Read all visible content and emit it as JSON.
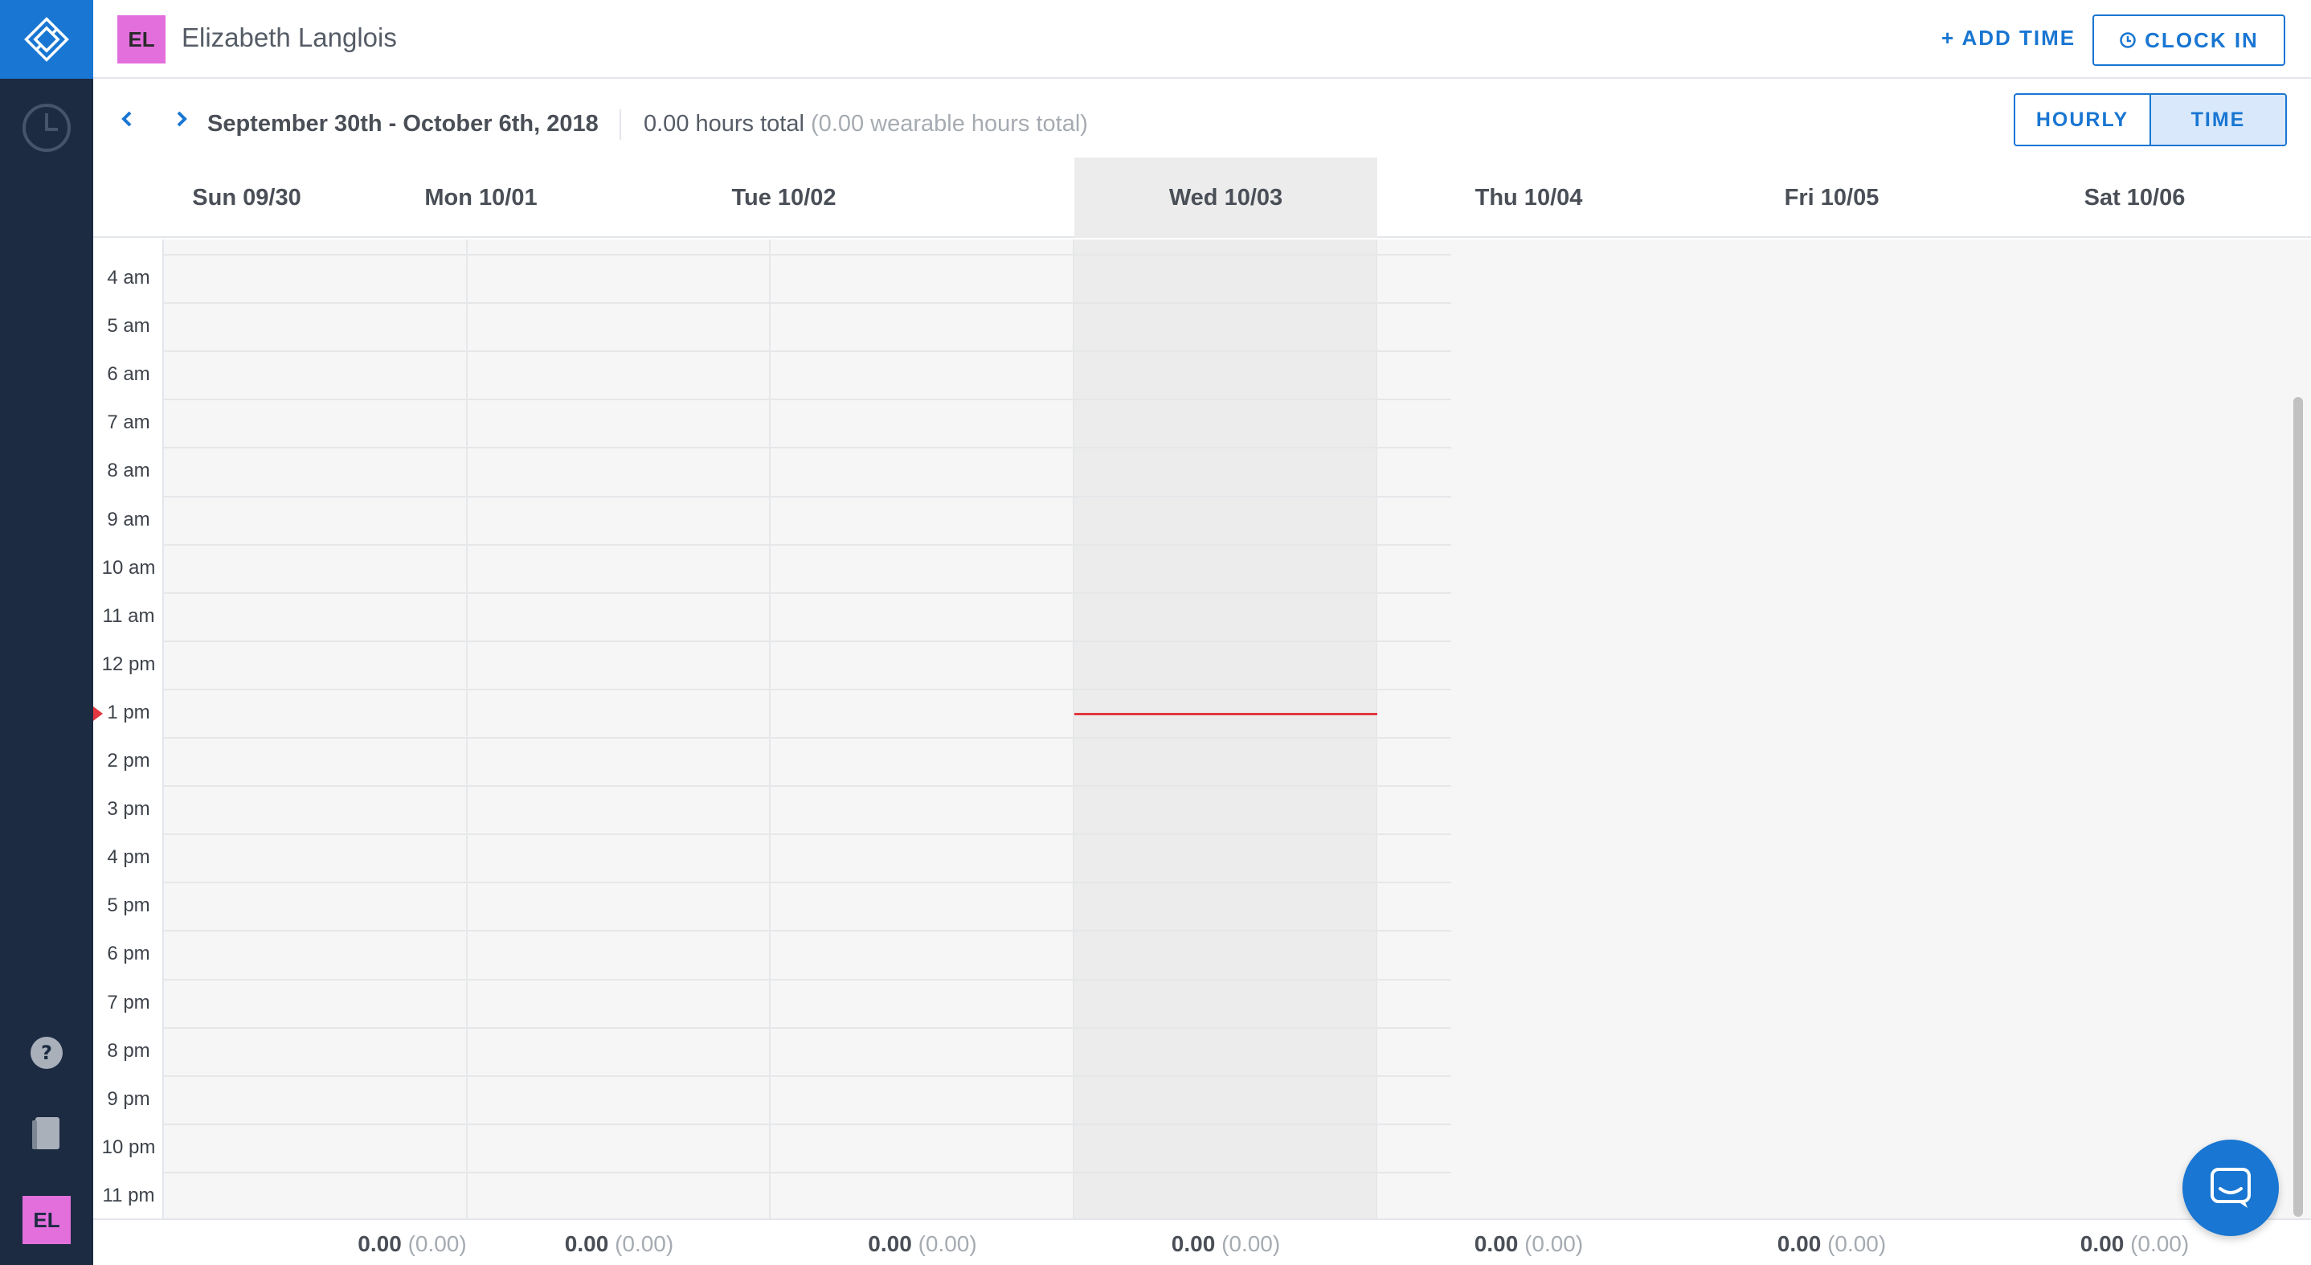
{
  "sidebar": {
    "logo_icon": "logo-icon",
    "items": [
      {
        "icon": "clock-icon"
      },
      {
        "icon": "help-icon"
      },
      {
        "icon": "book-icon"
      }
    ],
    "avatar_initials": "EL"
  },
  "header": {
    "avatar_initials": "EL",
    "user_name": "Elizabeth Langlois",
    "add_time_label": "+ ADD TIME",
    "clock_in_label": "CLOCK IN"
  },
  "subheader": {
    "date_range": "September 30th - October 6th, 2018",
    "hours_total": "0.00 hours total",
    "wearable_total": "(0.00 wearable hours total)",
    "view_options": [
      {
        "label": "HOURLY",
        "active": false
      },
      {
        "label": "TIME",
        "active": true
      }
    ]
  },
  "days": [
    {
      "label": "Sun 09/30",
      "total": "0.00",
      "wear": "(0.00)"
    },
    {
      "label": "Mon 10/01",
      "total": "0.00",
      "wear": "(0.00)"
    },
    {
      "label": "Tue 10/02",
      "total": "0.00",
      "wear": "(0.00)"
    },
    {
      "label": "Wed 10/03",
      "total": "0.00",
      "wear": "(0.00)",
      "today": true
    },
    {
      "label": "Thu 10/04",
      "total": "0.00",
      "wear": "(0.00)"
    },
    {
      "label": "Fri 10/05",
      "total": "0.00",
      "wear": "(0.00)"
    },
    {
      "label": "Sat 10/06",
      "total": "0.00",
      "wear": "(0.00)"
    }
  ],
  "hours": [
    "4 am",
    "5 am",
    "6 am",
    "7 am",
    "8 am",
    "9 am",
    "10 am",
    "11 am",
    "12 pm",
    "1 pm",
    "2 pm",
    "3 pm",
    "4 pm",
    "5 pm",
    "6 pm",
    "7 pm",
    "8 pm",
    "9 pm",
    "10 pm",
    "11 pm"
  ],
  "colors": {
    "accent": "#1976d2",
    "sidebar": "#1c2b42",
    "avatar": "#e36fdd",
    "now_line": "#e2373e"
  }
}
